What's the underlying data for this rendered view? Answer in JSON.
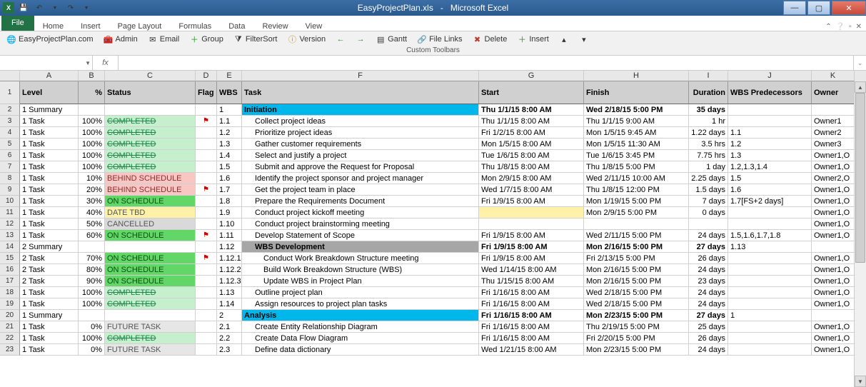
{
  "app": {
    "title_doc": "EasyProjectPlan.xls",
    "title_app": "Microsoft Excel"
  },
  "qat": {
    "save_tooltip": "Save",
    "undo": "↶",
    "redo": "↷"
  },
  "ribbon": {
    "file": "File",
    "tabs": [
      "Home",
      "Insert",
      "Page Layout",
      "Formulas",
      "Data",
      "Review",
      "View"
    ]
  },
  "custom_toolbar": {
    "site": "EasyProjectPlan.com",
    "admin": "Admin",
    "email": "Email",
    "group": "Group",
    "filtersort": "FilterSort",
    "version": "Version",
    "gantt": "Gantt",
    "filelinks": "File Links",
    "delete": "Delete",
    "insert": "Insert",
    "group_label": "Custom Toolbars"
  },
  "namebox": "",
  "fx": "fx",
  "columns": [
    "A",
    "B",
    "C",
    "D",
    "E",
    "F",
    "G",
    "H",
    "I",
    "J",
    "K"
  ],
  "headers": {
    "level": "Level",
    "pct": "%",
    "status": "Status",
    "flag": "Flag",
    "wbs": "WBS",
    "task": "Task",
    "start": "Start",
    "finish": "Finish",
    "duration": "Duration",
    "wbs_pred": "WBS Predecessors",
    "owner": "Owner"
  },
  "rows": [
    {
      "n": 2,
      "level": "1 Summary",
      "pct": "",
      "status": "",
      "status_cls": "",
      "flag": "",
      "wbs": "1",
      "task": "Initiation",
      "indent": 0,
      "start": "Thu 1/1/15 8:00 AM",
      "finish": "Wed 2/18/15 5:00 PM",
      "dur": "35 days",
      "pred": "",
      "owner": "",
      "rowcls": "row-summary",
      "bold": true
    },
    {
      "n": 3,
      "level": "1 Task",
      "pct": "100%",
      "status": "COMPLETED",
      "status_cls": "st-completed",
      "flag": "⚑",
      "wbs": "1.1",
      "task": "Collect project ideas",
      "indent": 1,
      "start": "Thu 1/1/15 8:00 AM",
      "finish": "Thu 1/1/15 9:00 AM",
      "dur": "1 hr",
      "pred": "",
      "owner": "Owner1"
    },
    {
      "n": 4,
      "level": "1 Task",
      "pct": "100%",
      "status": "COMPLETED",
      "status_cls": "st-completed",
      "flag": "",
      "wbs": "1.2",
      "task": "Prioritize project ideas",
      "indent": 1,
      "start": "Fri 1/2/15 8:00 AM",
      "finish": "Mon 1/5/15 9:45 AM",
      "dur": "1.22 days",
      "pred": "1.1",
      "owner": "Owner2"
    },
    {
      "n": 5,
      "level": "1 Task",
      "pct": "100%",
      "status": "COMPLETED",
      "status_cls": "st-completed",
      "flag": "",
      "wbs": "1.3",
      "task": "Gather customer requirements",
      "indent": 1,
      "start": "Mon 1/5/15 8:00 AM",
      "finish": "Mon 1/5/15 11:30 AM",
      "dur": "3.5 hrs",
      "pred": "1.2",
      "owner": "Owner3"
    },
    {
      "n": 6,
      "level": "1 Task",
      "pct": "100%",
      "status": "COMPLETED",
      "status_cls": "st-completed",
      "flag": "",
      "wbs": "1.4",
      "task": "Select and justify a project",
      "indent": 1,
      "start": "Tue 1/6/15 8:00 AM",
      "finish": "Tue 1/6/15 3:45 PM",
      "dur": "7.75 hrs",
      "pred": "1.3",
      "owner": "Owner1,O"
    },
    {
      "n": 7,
      "level": "1 Task",
      "pct": "100%",
      "status": "COMPLETED",
      "status_cls": "st-completed",
      "flag": "",
      "wbs": "1.5",
      "task": "Submit and approve the Request for Proposal",
      "indent": 1,
      "start": "Thu 1/8/15 8:00 AM",
      "finish": "Thu 1/8/15 5:00 PM",
      "dur": "1 day",
      "pred": "1.2,1.3,1.4",
      "owner": "Owner1,O"
    },
    {
      "n": 8,
      "level": "1 Task",
      "pct": "10%",
      "status": "BEHIND SCHEDULE",
      "status_cls": "st-behind",
      "flag": "",
      "wbs": "1.6",
      "task": "Identify the project sponsor and project manager",
      "indent": 1,
      "start": "Mon 2/9/15 8:00 AM",
      "finish": "Wed 2/11/15 10:00 AM",
      "dur": "2.25 days",
      "pred": "1.5",
      "owner": "Owner2,O"
    },
    {
      "n": 9,
      "level": "1 Task",
      "pct": "20%",
      "status": "BEHIND SCHEDULE",
      "status_cls": "st-behind",
      "flag": "⚑",
      "wbs": "1.7",
      "task": "Get the project team in place",
      "indent": 1,
      "start": "Wed 1/7/15 8:00 AM",
      "finish": "Thu 1/8/15 12:00 PM",
      "dur": "1.5 days",
      "pred": "1.6",
      "owner": "Owner1,O"
    },
    {
      "n": 10,
      "level": "1 Task",
      "pct": "30%",
      "status": "ON SCHEDULE",
      "status_cls": "st-onschedule",
      "flag": "",
      "wbs": "1.8",
      "task": "Prepare the Requirements Document",
      "indent": 1,
      "start": "Fri 1/9/15 8:00 AM",
      "finish": "Mon 1/19/15 5:00 PM",
      "dur": "7 days",
      "pred": "1.7[FS+2 days]",
      "owner": "Owner1,O"
    },
    {
      "n": 11,
      "level": "1 Task",
      "pct": "40%",
      "status": "DATE TBD",
      "status_cls": "st-datetbd",
      "flag": "",
      "wbs": "1.9",
      "task": "Conduct project kickoff meeting",
      "indent": 1,
      "start": "",
      "finish": "Mon 2/9/15 5:00 PM",
      "dur": "0 days",
      "pred": "",
      "owner": "Owner1,O",
      "rowcls": "row-yellow"
    },
    {
      "n": 12,
      "level": "1 Task",
      "pct": "50%",
      "status": "CANCELLED",
      "status_cls": "st-cancelled",
      "flag": "",
      "wbs": "1.10",
      "task": "Conduct project brainstorming meeting",
      "indent": 1,
      "start": "",
      "finish": "",
      "dur": "",
      "pred": "",
      "owner": "Owner1,O"
    },
    {
      "n": 13,
      "level": "1 Task",
      "pct": "60%",
      "status": "ON SCHEDULE",
      "status_cls": "st-onschedule",
      "flag": "⚑",
      "wbs": "1.11",
      "task": "Develop Statement of Scope",
      "indent": 1,
      "start": "Fri 1/9/15 8:00 AM",
      "finish": "Wed 2/11/15 5:00 PM",
      "dur": "24 days",
      "pred": "1.5,1.6,1.7,1.8",
      "owner": "Owner1,O"
    },
    {
      "n": 14,
      "level": "2 Summary",
      "pct": "",
      "status": "",
      "status_cls": "",
      "flag": "",
      "wbs": "1.12",
      "task": "WBS Development",
      "indent": 1,
      "start": "Fri 1/9/15 8:00 AM",
      "finish": "Mon 2/16/15 5:00 PM",
      "dur": "27 days",
      "pred": "1.13",
      "owner": "",
      "rowcls": "row-wbsdev",
      "bold": true
    },
    {
      "n": 15,
      "level": "2 Task",
      "pct": "70%",
      "status": "ON SCHEDULE",
      "status_cls": "st-onschedule",
      "flag": "⚑",
      "wbs": "1.12.1",
      "task": "Conduct Work Breakdown Structure meeting",
      "indent": 2,
      "start": "Fri 1/9/15 8:00 AM",
      "finish": "Fri 2/13/15 5:00 PM",
      "dur": "26 days",
      "pred": "",
      "owner": "Owner1,O"
    },
    {
      "n": 16,
      "level": "2 Task",
      "pct": "80%",
      "status": "ON SCHEDULE",
      "status_cls": "st-onschedule",
      "flag": "",
      "wbs": "1.12.2",
      "task": "Build Work Breakdown Structure (WBS)",
      "indent": 2,
      "start": "Wed 1/14/15 8:00 AM",
      "finish": "Mon 2/16/15 5:00 PM",
      "dur": "24 days",
      "pred": "",
      "owner": "Owner1,O"
    },
    {
      "n": 17,
      "level": "2 Task",
      "pct": "90%",
      "status": "ON SCHEDULE",
      "status_cls": "st-onschedule",
      "flag": "",
      "wbs": "1.12.3",
      "task": "Update WBS in Project Plan",
      "indent": 2,
      "start": "Thu 1/15/15 8:00 AM",
      "finish": "Mon 2/16/15 5:00 PM",
      "dur": "23 days",
      "pred": "",
      "owner": "Owner1,O"
    },
    {
      "n": 18,
      "level": "1 Task",
      "pct": "100%",
      "status": "COMPLETED",
      "status_cls": "st-completed",
      "flag": "",
      "wbs": "1.13",
      "task": "Outline project plan",
      "indent": 1,
      "start": "Fri 1/16/15 8:00 AM",
      "finish": "Wed 2/18/15 5:00 PM",
      "dur": "24 days",
      "pred": "",
      "owner": "Owner1,O"
    },
    {
      "n": 19,
      "level": "1 Task",
      "pct": "100%",
      "status": "COMPLETED",
      "status_cls": "st-completed",
      "flag": "",
      "wbs": "1.14",
      "task": "Assign resources to project plan tasks",
      "indent": 1,
      "start": "Fri 1/16/15 8:00 AM",
      "finish": "Wed 2/18/15 5:00 PM",
      "dur": "24 days",
      "pred": "",
      "owner": "Owner1,O"
    },
    {
      "n": 20,
      "level": "1 Summary",
      "pct": "",
      "status": "",
      "status_cls": "",
      "flag": "",
      "wbs": "2",
      "task": "Analysis",
      "indent": 0,
      "start": "Fri 1/16/15 8:00 AM",
      "finish": "Mon 2/23/15 5:00 PM",
      "dur": "27 days",
      "pred": "1",
      "owner": "",
      "rowcls": "row-summary",
      "bold": true
    },
    {
      "n": 21,
      "level": "1 Task",
      "pct": "0%",
      "status": "FUTURE TASK",
      "status_cls": "st-future",
      "flag": "",
      "wbs": "2.1",
      "task": "Create Entity Relationship Diagram",
      "indent": 1,
      "start": "Fri 1/16/15 8:00 AM",
      "finish": "Thu 2/19/15 5:00 PM",
      "dur": "25 days",
      "pred": "",
      "owner": "Owner1,O"
    },
    {
      "n": 22,
      "level": "1 Task",
      "pct": "100%",
      "status": "COMPLETED",
      "status_cls": "st-completed",
      "flag": "",
      "wbs": "2.2",
      "task": "Create Data Flow Diagram",
      "indent": 1,
      "start": "Fri 1/16/15 8:00 AM",
      "finish": "Fri 2/20/15 5:00 PM",
      "dur": "26 days",
      "pred": "",
      "owner": "Owner1,O"
    },
    {
      "n": 23,
      "level": "1 Task",
      "pct": "0%",
      "status": "FUTURE TASK",
      "status_cls": "st-future",
      "flag": "",
      "wbs": "2.3",
      "task": "Define data dictionary",
      "indent": 1,
      "start": "Wed 1/21/15 8:00 AM",
      "finish": "Mon 2/23/15 5:00 PM",
      "dur": "24 days",
      "pred": "",
      "owner": "Owner1,O"
    }
  ]
}
